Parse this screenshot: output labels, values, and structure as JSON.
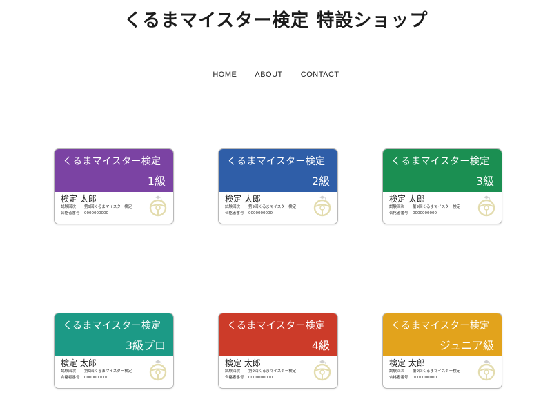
{
  "site": {
    "title": "くるまマイスター検定 特設ショップ"
  },
  "nav": {
    "items": [
      {
        "label": "HOME"
      },
      {
        "label": "ABOUT"
      },
      {
        "label": "CONTACT"
      }
    ]
  },
  "cards": [
    {
      "exam": "くるまマイスター検定",
      "grade": "1級",
      "color": "#7b43a3",
      "name": "検定 太郎",
      "row1_label": "試験回次",
      "row1_value": "第9回くるまマイスター検定",
      "row2_label": "合格者番号",
      "row2_value": "0000000000"
    },
    {
      "exam": "くるまマイスター検定",
      "grade": "2級",
      "color": "#2f5ea8",
      "name": "検定 太郎",
      "row1_label": "試験回次",
      "row1_value": "第9回くるまマイスター検定",
      "row2_label": "合格者番号",
      "row2_value": "0000000000"
    },
    {
      "exam": "くるまマイスター検定",
      "grade": "3級",
      "color": "#1b8f52",
      "name": "検定 太郎",
      "row1_label": "試験回次",
      "row1_value": "第9回くるまマイスター検定",
      "row2_label": "合格者番号",
      "row2_value": "0000000000"
    },
    {
      "exam": "くるまマイスター検定",
      "grade": "3級プロ",
      "color": "#1c9a86",
      "name": "検定 太郎",
      "row1_label": "試験回次",
      "row1_value": "第9回くるまマイスター検定",
      "row2_label": "合格者番号",
      "row2_value": "0000000000"
    },
    {
      "exam": "くるまマイスター検定",
      "grade": "4級",
      "color": "#cc3b29",
      "name": "検定 太郎",
      "row1_label": "試験回次",
      "row1_value": "第9回くるまマイスター検定",
      "row2_label": "合格者番号",
      "row2_value": "0000000000"
    },
    {
      "exam": "くるまマイスター検定",
      "grade": "ジュニア級",
      "color": "#e2a31c",
      "name": "検定 太郎",
      "row1_label": "試験回次",
      "row1_value": "第9回くるまマイスター検定",
      "row2_label": "合格者番号",
      "row2_value": "0000000000"
    }
  ],
  "icons": {
    "card_emblem": "steering-wheel-icon"
  }
}
